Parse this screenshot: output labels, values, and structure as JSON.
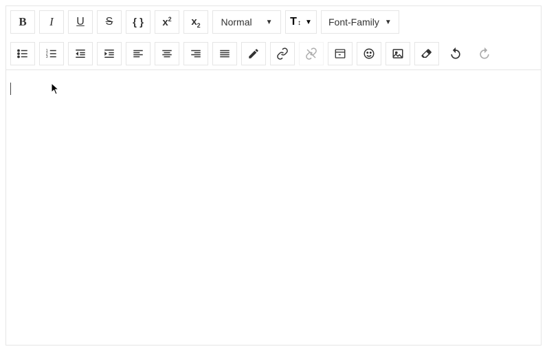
{
  "toolbar": {
    "heading_label": "Normal",
    "font_family_label": "Font-Family",
    "buttons": {
      "bold": "Bold",
      "italic": "Italic",
      "underline": "Underline",
      "strike": "Strikethrough",
      "code": "Code",
      "superscript": "Superscript",
      "subscript": "Subscript",
      "ul": "Unordered List",
      "ol": "Ordered List",
      "outdent": "Outdent",
      "indent": "Indent",
      "align_left": "Align Left",
      "align_center": "Align Center",
      "align_right": "Align Right",
      "align_justify": "Align Justify",
      "color": "Text Color",
      "link": "Insert Link",
      "unlink": "Remove Link",
      "embed": "Embed",
      "emoji": "Emoji",
      "image": "Insert Image",
      "eraser": "Clear Formatting",
      "undo": "Undo",
      "redo": "Redo"
    }
  },
  "editor": {
    "content": ""
  }
}
